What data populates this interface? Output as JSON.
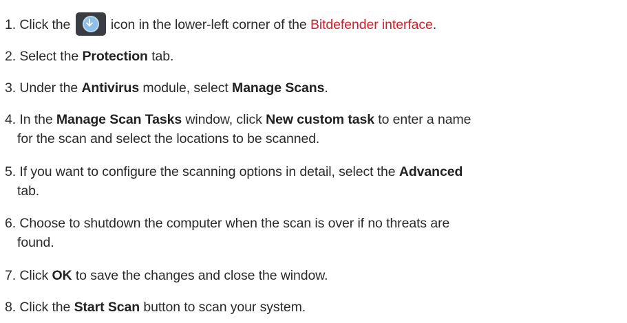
{
  "steps": [
    {
      "num": "1.",
      "parts": {
        "t1": " Click the ",
        "icon": "download-arrow-icon",
        "t2": " icon in the lower-left corner of the ",
        "link": "Bitdefender interface",
        "t3": "."
      }
    },
    {
      "num": "2.",
      "parts": {
        "t1": " Select the ",
        "b1": "Protection",
        "t2": " tab."
      }
    },
    {
      "num": "3.",
      "parts": {
        "t1": " Under the ",
        "b1": "Antivirus",
        "t2": " module, select ",
        "b2": "Manage Scans",
        "t3": "."
      }
    },
    {
      "num": "4.",
      "parts": {
        "t1": " In the ",
        "b1": "Manage Scan Tasks",
        "t2": " window, click ",
        "b2": "New custom task",
        "t3": " to enter a name",
        "t4": "for the scan and select the locations to be scanned."
      }
    },
    {
      "num": "5.",
      "parts": {
        "t1": " If you want to configure the scanning options in detail, select the ",
        "b1": "Advanced",
        "t2": "tab."
      }
    },
    {
      "num": "6.",
      "parts": {
        "t1": " Choose to shutdown the computer when the scan is over if no threats are",
        "t2": "found."
      }
    },
    {
      "num": "7.",
      "parts": {
        "t1": " Click ",
        "b1": "OK",
        "t2": " to save the changes and close the window."
      }
    },
    {
      "num": "8.",
      "parts": {
        "t1": " Click the ",
        "b1": "Start Scan",
        "t2": " button to scan your system."
      }
    }
  ],
  "colors": {
    "text": "#2a2a2a",
    "link": "#d0202a",
    "icon_bg": "#3a3d44",
    "icon_circle": "#8fbfe8"
  }
}
